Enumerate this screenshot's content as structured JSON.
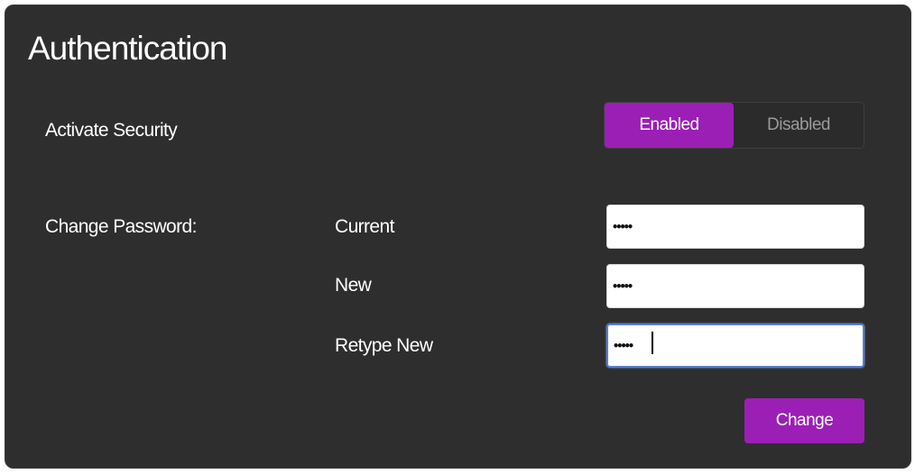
{
  "section": {
    "title": "Authentication"
  },
  "security": {
    "label": "Activate Security",
    "enabled_label": "Enabled",
    "disabled_label": "Disabled",
    "selected": "Enabled"
  },
  "password": {
    "label": "Change Password:",
    "fields": [
      {
        "label": "Current",
        "value": "•••••"
      },
      {
        "label": "New",
        "value": "•••••"
      },
      {
        "label": "Retype New",
        "value": "•••••"
      }
    ],
    "change_label": "Change"
  },
  "colors": {
    "panel_background": "#2e2e2e",
    "accent": "#9b1fb5",
    "text": "#ffffff",
    "inactive_text": "#9a9a9a",
    "focus_border": "#5a7fd0"
  }
}
